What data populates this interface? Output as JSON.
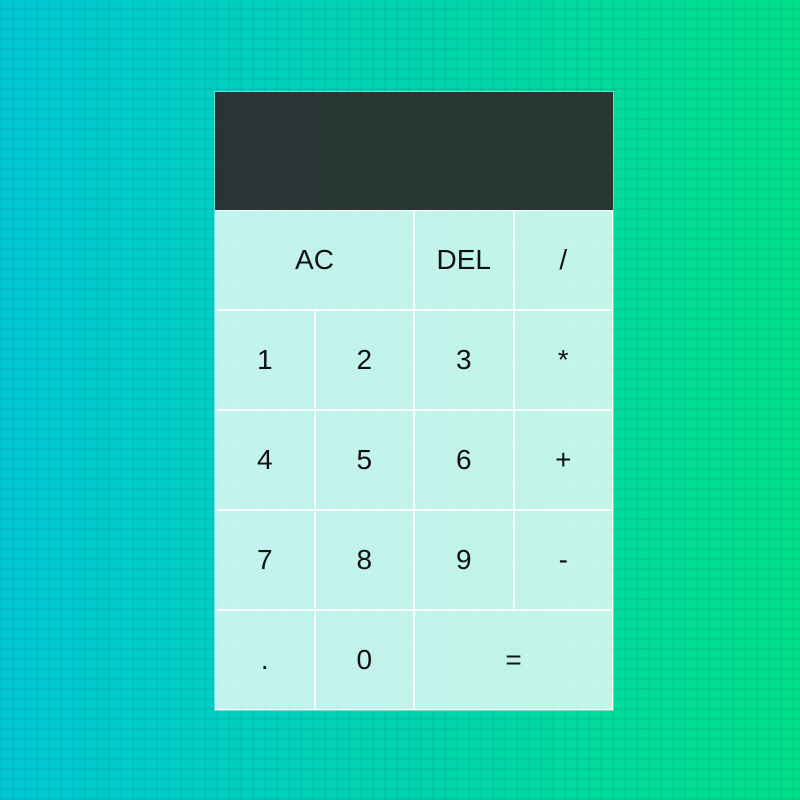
{
  "display": {
    "previous_operand": "",
    "current_operand": ""
  },
  "keys": {
    "ac": "AC",
    "del": "DEL",
    "divide": "/",
    "one": "1",
    "two": "2",
    "three": "3",
    "multiply": "*",
    "four": "4",
    "five": "5",
    "six": "6",
    "add": "+",
    "seven": "7",
    "eight": "8",
    "nine": "9",
    "subtract": "-",
    "decimal": ".",
    "zero": "0",
    "equals": "="
  },
  "colors": {
    "background_start": "#00c8d6",
    "background_end": "#00e08a",
    "display_background": "#0a2a22",
    "keypad_background": "#c8f4ea"
  }
}
